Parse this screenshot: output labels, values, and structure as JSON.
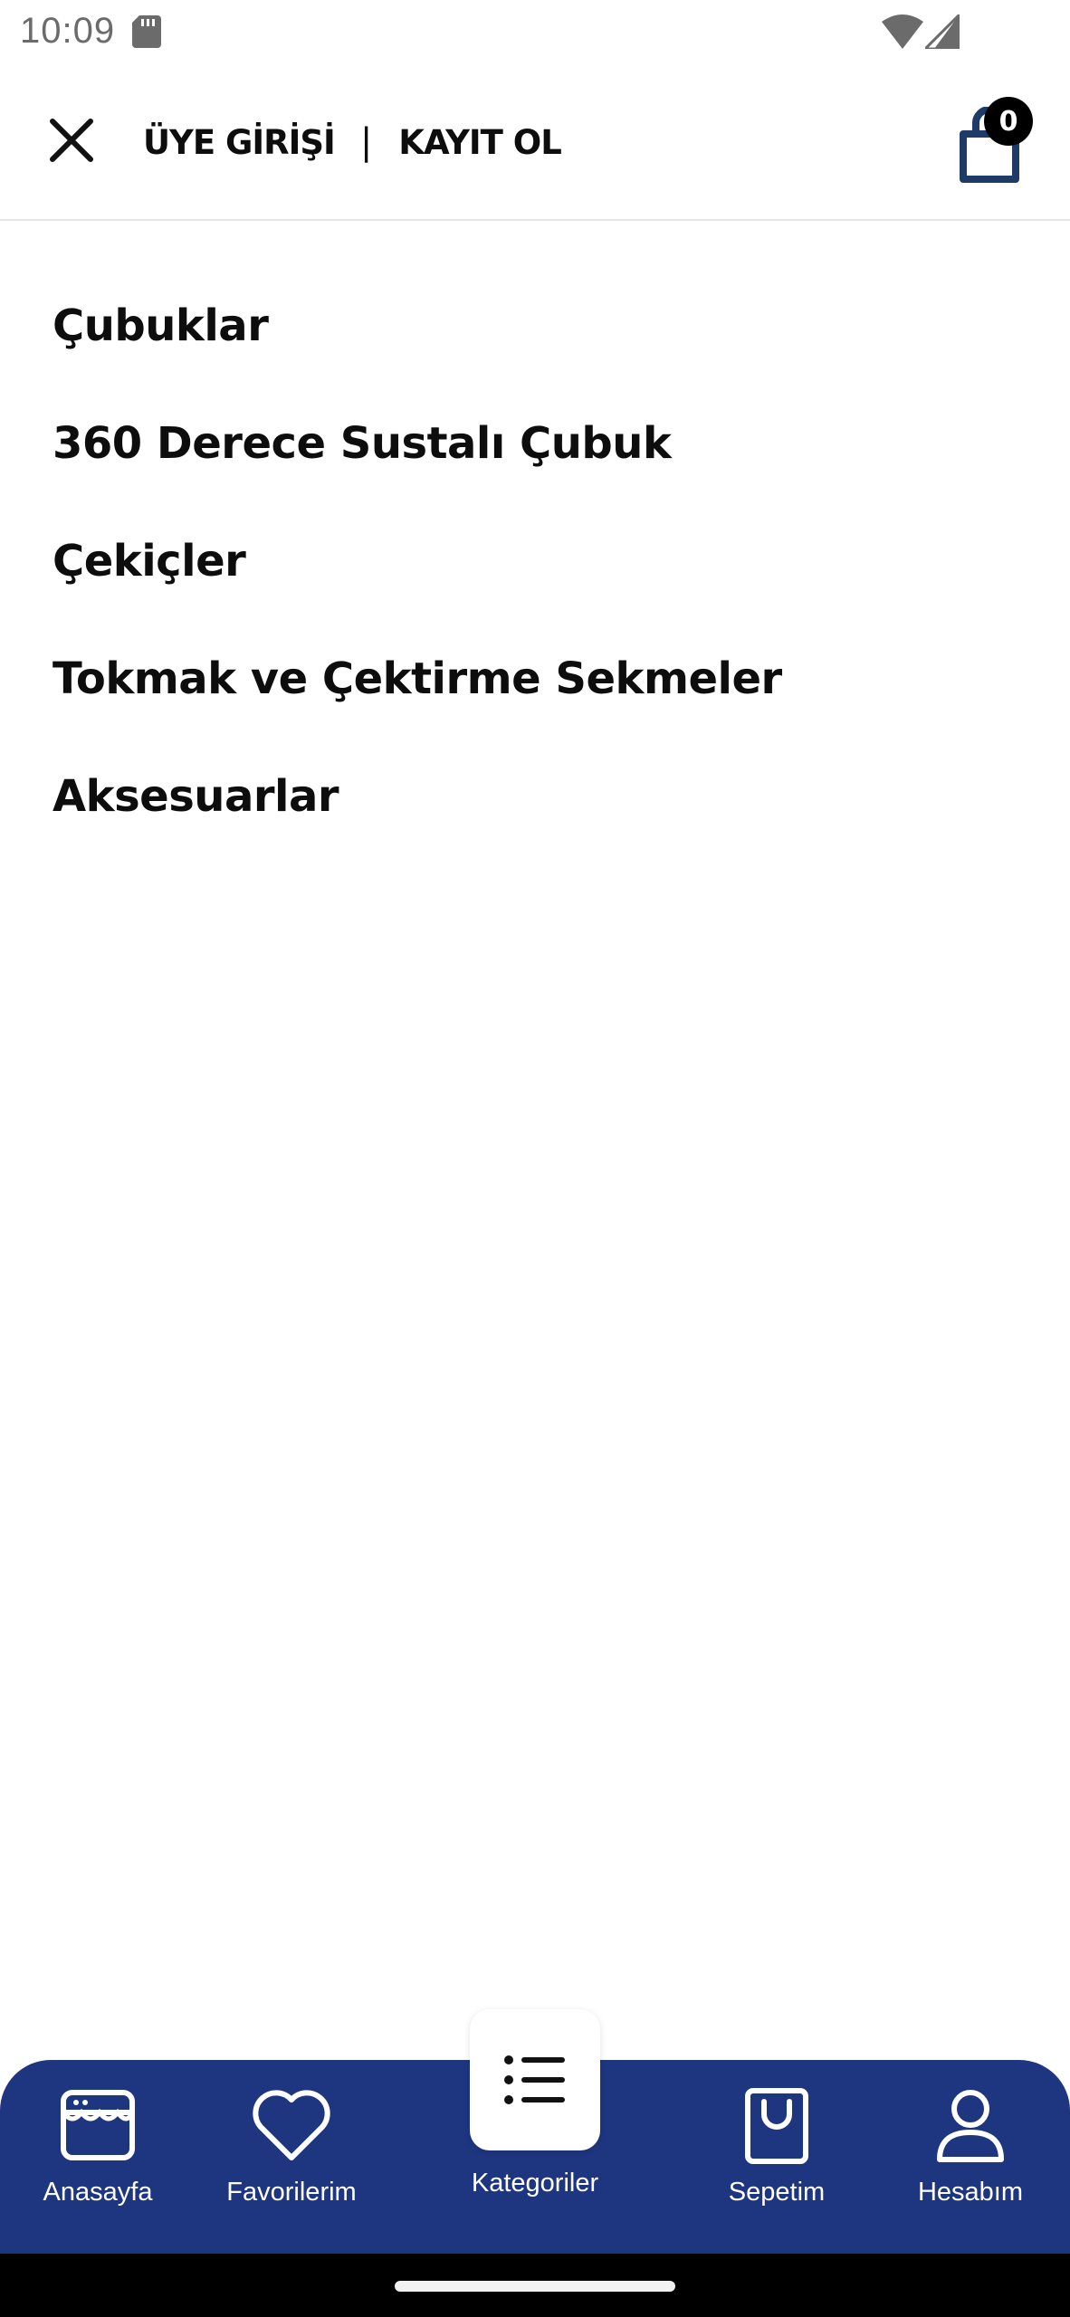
{
  "status_bar": {
    "time": "10:09",
    "icons": [
      "sd-card-icon",
      "wifi-icon",
      "signal-icon"
    ]
  },
  "header": {
    "close_icon": "close-icon",
    "login_label": "ÜYE GİRİŞİ",
    "separator": "|",
    "register_label": "KAYIT OL",
    "cart_icon": "shopping-bag-icon",
    "cart_count": "0"
  },
  "categories": [
    {
      "label": "Çubuklar"
    },
    {
      "label": "360 Derece Sustalı Çubuk"
    },
    {
      "label": "Çekiçler"
    },
    {
      "label": "Tokmak ve Çektirme Sekmeler"
    },
    {
      "label": "Aksesuarlar"
    }
  ],
  "bottom_nav": {
    "items": [
      {
        "label": "Anasayfa",
        "icon": "store-icon"
      },
      {
        "label": "Favorilerim",
        "icon": "heart-icon"
      },
      {
        "label": "Kategoriler",
        "icon": "list-icon",
        "active": true
      },
      {
        "label": "Sepetim",
        "icon": "bag-icon"
      },
      {
        "label": "Hesabım",
        "icon": "user-icon"
      }
    ]
  },
  "colors": {
    "nav_background": "#1e3580",
    "cart_icon": "#1e3a66",
    "badge": "#000000",
    "text": "#0d0d0d"
  }
}
